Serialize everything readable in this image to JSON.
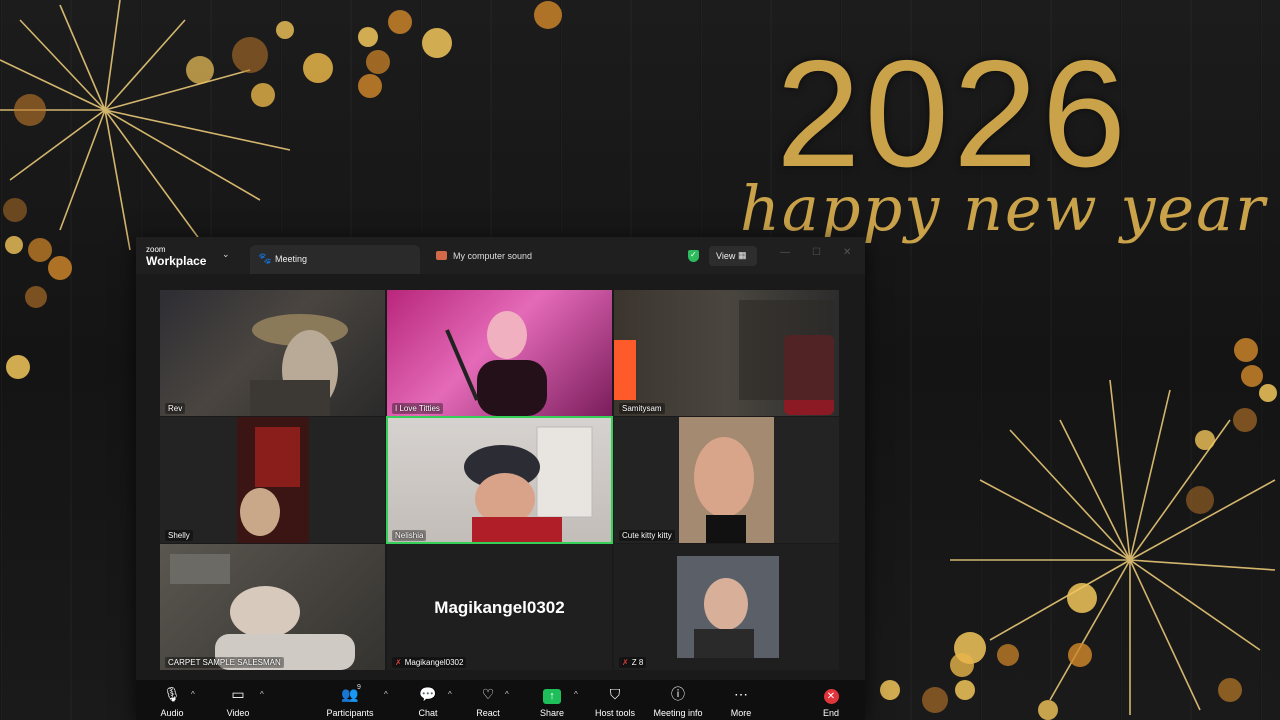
{
  "background": {
    "year": "2026",
    "greeting": "happy new year"
  },
  "window": {
    "brand_small": "zoom",
    "brand_big": "Workplace",
    "tab_meeting": "Meeting",
    "tab_sound": "My computer sound",
    "view_label": "View"
  },
  "tiles": [
    {
      "name": "Rev"
    },
    {
      "name": "I Love Titties"
    },
    {
      "name": "Samitysam"
    },
    {
      "name": "Shelly"
    },
    {
      "name": "Nelishia",
      "active": true
    },
    {
      "name": "Cute kitty kitty"
    },
    {
      "name": "CARPET SAMPLE SALESMAN"
    },
    {
      "name": "Magikangel0302",
      "muted": true,
      "display_name": "Magikangel0302"
    },
    {
      "name": "Z 8",
      "muted": true
    }
  ],
  "toolbar": {
    "audio": "Audio",
    "video": "Video",
    "participants": "Participants",
    "participant_count": "9",
    "chat": "Chat",
    "react": "React",
    "share": "Share",
    "host_tools": "Host tools",
    "meeting_info": "Meeting info",
    "more": "More",
    "end": "End"
  },
  "colors": {
    "gold": "#c9a24a",
    "active_speaker": "#34d058",
    "share_green": "#1ebe5b",
    "end_red": "#e0353b"
  }
}
